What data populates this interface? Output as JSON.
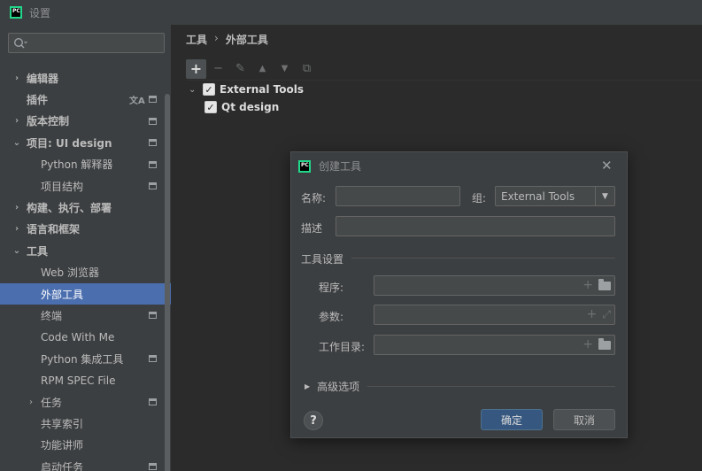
{
  "window": {
    "title": "设置"
  },
  "search": {
    "placeholder": ""
  },
  "sidebar": {
    "items": [
      {
        "label": "编辑器",
        "arrow": "›",
        "bold": true,
        "indent": 0,
        "cfg": false
      },
      {
        "label": "插件",
        "arrow": "",
        "bold": true,
        "indent": 0,
        "cfg": true,
        "trans": true
      },
      {
        "label": "版本控制",
        "arrow": "›",
        "bold": true,
        "indent": 0,
        "cfg": true
      },
      {
        "label": "项目: UI design",
        "arrow": "⌄",
        "bold": true,
        "indent": 0,
        "cfg": true
      },
      {
        "label": "Python 解释器",
        "arrow": "",
        "bold": false,
        "indent": 1,
        "cfg": true
      },
      {
        "label": "项目结构",
        "arrow": "",
        "bold": false,
        "indent": 1,
        "cfg": true
      },
      {
        "label": "构建、执行、部署",
        "arrow": "›",
        "bold": true,
        "indent": 0,
        "cfg": false
      },
      {
        "label": "语言和框架",
        "arrow": "›",
        "bold": true,
        "indent": 0,
        "cfg": false
      },
      {
        "label": "工具",
        "arrow": "⌄",
        "bold": true,
        "indent": 0,
        "cfg": false
      },
      {
        "label": "Web 浏览器",
        "arrow": "",
        "bold": false,
        "indent": 1,
        "cfg": false
      },
      {
        "label": "外部工具",
        "arrow": "",
        "bold": false,
        "indent": 1,
        "cfg": false,
        "selected": true
      },
      {
        "label": "终端",
        "arrow": "",
        "bold": false,
        "indent": 1,
        "cfg": true
      },
      {
        "label": "Code With Me",
        "arrow": "",
        "bold": false,
        "indent": 1,
        "cfg": false
      },
      {
        "label": "Python 集成工具",
        "arrow": "",
        "bold": false,
        "indent": 1,
        "cfg": true
      },
      {
        "label": "RPM SPEC File",
        "arrow": "",
        "bold": false,
        "indent": 1,
        "cfg": false
      },
      {
        "label": "任务",
        "arrow": "›",
        "bold": false,
        "indent": 1,
        "cfg": true
      },
      {
        "label": "共享索引",
        "arrow": "",
        "bold": false,
        "indent": 1,
        "cfg": false
      },
      {
        "label": "功能讲师",
        "arrow": "",
        "bold": false,
        "indent": 1,
        "cfg": false
      },
      {
        "label": "启动任务",
        "arrow": "",
        "bold": false,
        "indent": 1,
        "cfg": true
      }
    ]
  },
  "breadcrumb": {
    "root": "工具",
    "separator": "›",
    "current": "外部工具"
  },
  "toolbar": {
    "add": "+",
    "remove": "−",
    "edit": "✎",
    "up": "▲",
    "down": "▼",
    "copy": "⧉"
  },
  "tools": {
    "group": {
      "label": "External Tools",
      "checked": true
    },
    "items": [
      {
        "label": "Qt design",
        "checked": true
      }
    ]
  },
  "dialog": {
    "title": "创建工具",
    "name_label": "名称:",
    "name_value": "",
    "group_label": "组:",
    "group_value": "External Tools",
    "description_label": "描述",
    "description_value": "",
    "tool_settings_label": "工具设置",
    "program_label": "程序:",
    "arguments_label": "参数:",
    "working_dir_label": "工作目录:",
    "advanced_label": "高级选项",
    "help_label": "?",
    "ok_label": "确定",
    "cancel_label": "取消"
  },
  "colors": {
    "selection": "#4b6eaf",
    "ok_button": "#365880",
    "background": "#3c3f41",
    "panel": "#2b2b2b"
  }
}
